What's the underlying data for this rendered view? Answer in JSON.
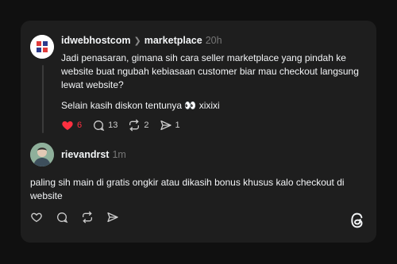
{
  "post": {
    "username": "idwebhostcom",
    "community": "marketplace",
    "time": "20h",
    "paragraphs": [
      "Jadi penasaran, gimana sih cara seller marketplace yang pindah ke website buat ngubah kebiasaan customer biar mau checkout langsung lewat website?",
      "Selain kasih diskon tentunya 👀 xixixi"
    ],
    "likes": "6",
    "replies": "13",
    "reposts": "2",
    "shares": "1",
    "liked": true
  },
  "reply": {
    "username": "rievandrst",
    "time": "1m",
    "text": "paling sih main di gratis ongkir atau dikasih bonus khusus kalo checkout di website"
  },
  "colors": {
    "background": "#101010",
    "card": "#1e1e1e",
    "like_active": "#ff3040",
    "text": "#f3f5f7",
    "muted": "#777777"
  },
  "icons": {
    "heart": "heart-icon",
    "comment": "comment-icon",
    "repost": "repost-icon",
    "share": "share-icon",
    "logo": "threads-logo-icon",
    "chevron": "chevron-right-icon"
  }
}
